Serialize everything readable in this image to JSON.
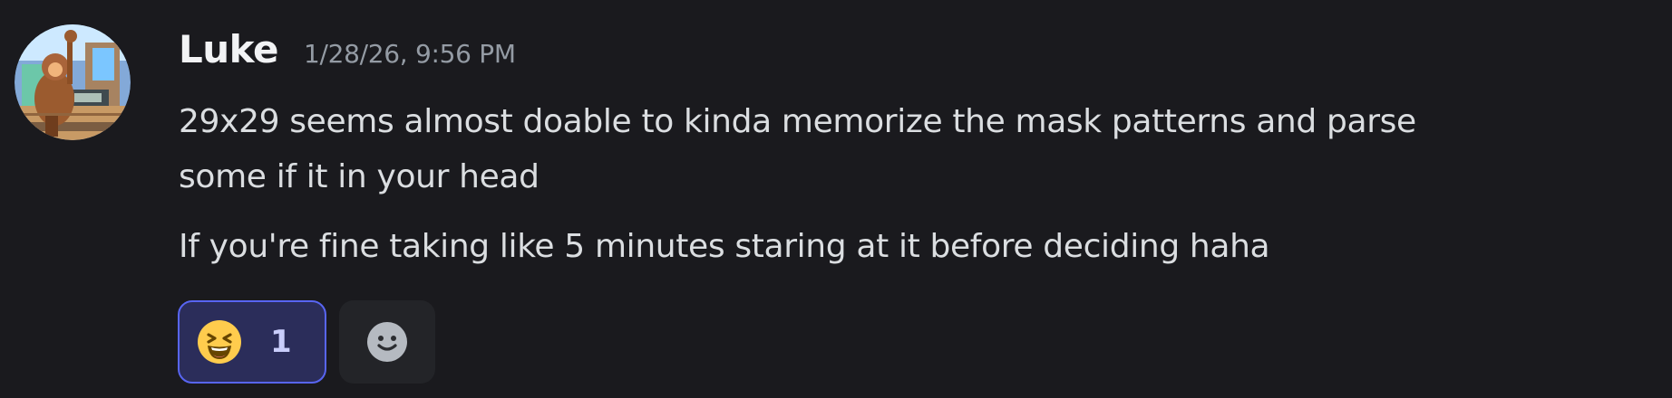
{
  "message": {
    "author": "Luke",
    "timestamp": "1/28/26, 9:56 PM",
    "lines": [
      "29x29 seems almost doable to kinda memorize the mask patterns and parse",
      "some if it in your head",
      "If you're fine taking like 5 minutes staring at it before deciding haha"
    ]
  },
  "reactions": [
    {
      "emoji": "laughing-emoji",
      "count": "1",
      "selected": true
    }
  ],
  "add_reaction_icon": "smile-add-reaction-icon",
  "colors": {
    "background": "#1a1a1e",
    "username": "#f2f3f5",
    "timestamp": "#949ba4",
    "text": "#dbdee1",
    "reaction_selected_bg": "#2b2d5a",
    "reaction_selected_border": "#5865f2",
    "reaction_count": "#c9cdfb"
  }
}
